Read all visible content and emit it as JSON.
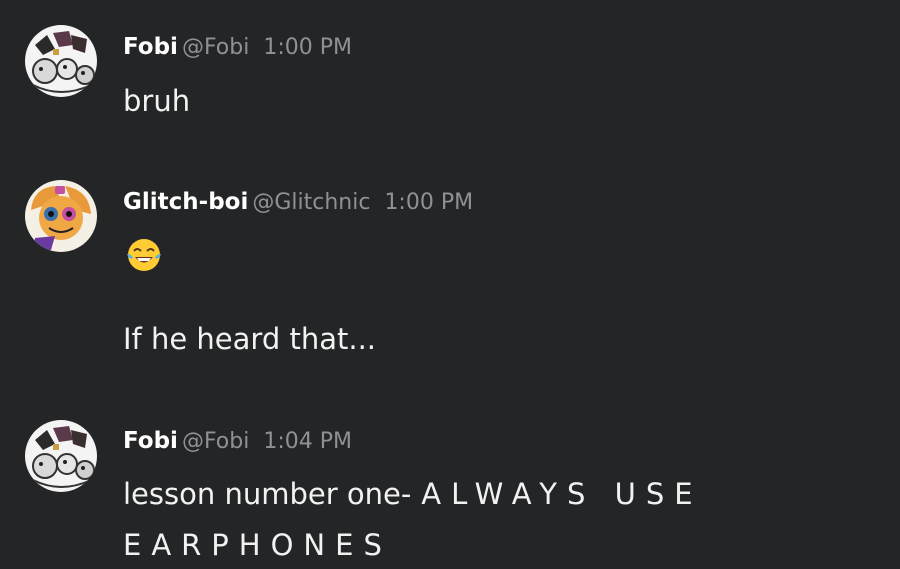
{
  "messages": [
    {
      "author": "Fobi",
      "handle": "@Fobi",
      "time": "1:00 PM",
      "avatar_icon": "fobi-avatar-icon",
      "lines": [
        "bruh"
      ]
    },
    {
      "author": "Glitch-boi",
      "handle": "@Glitchnic",
      "time": "1:00 PM",
      "avatar_icon": "glitchboi-avatar-icon",
      "emoji": "face-with-tears-of-joy-icon",
      "lines": [
        "If he heard that..."
      ]
    },
    {
      "author": "Fobi",
      "handle": "@Fobi",
      "time": "1:04 PM",
      "avatar_icon": "fobi-avatar-icon",
      "lines": [
        "lesson number one-",
        "ALWAYS  USE",
        "EARPHONES"
      ]
    }
  ],
  "colors": {
    "background": "#232526",
    "author": "#ffffff",
    "muted": "#8e9297",
    "text": "#f2f2f2"
  }
}
